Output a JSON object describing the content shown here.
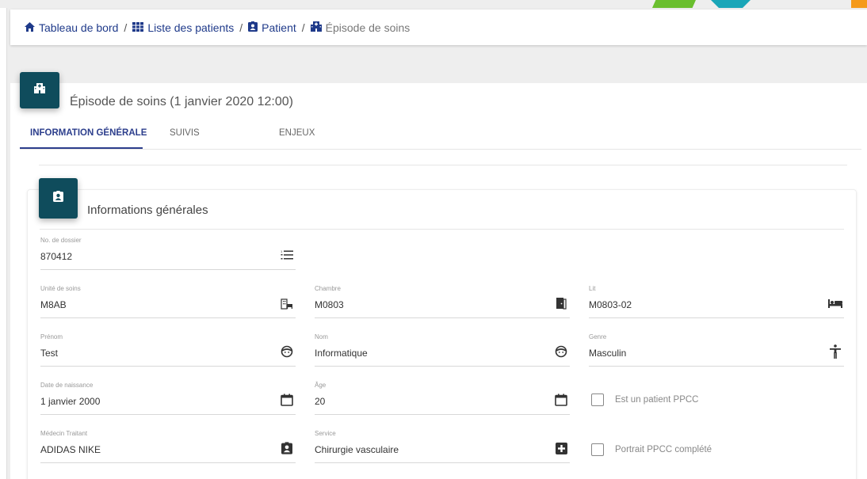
{
  "breadcrumb": {
    "items": [
      {
        "label": "Tableau de bord",
        "icon": "home-icon"
      },
      {
        "label": "Liste des patients",
        "icon": "list-icon"
      },
      {
        "label": "Patient",
        "icon": "patient-card-icon"
      },
      {
        "label": "Épisode de soins",
        "icon": "hospital-icon"
      }
    ],
    "separator": "/"
  },
  "episode": {
    "title": "Épisode de soins (1 janvier 2020 12:00)",
    "icon": "hospital-icon"
  },
  "tabs": [
    {
      "label": "INFORMATION GÉNÉRALE",
      "active": true
    },
    {
      "label": "SUIVIS",
      "active": false
    },
    {
      "label": "ENJEUX",
      "active": false
    }
  ],
  "info": {
    "title": "Informations générales",
    "icon": "patient-card-icon",
    "fields": {
      "dossier": {
        "label": "No. de dossier",
        "value": "870412",
        "icon": "numbered-list-icon"
      },
      "unite": {
        "label": "Unité de soins",
        "value": "M8AB",
        "icon": "hospital-building-icon"
      },
      "chambre": {
        "label": "Chambre",
        "value": "M0803",
        "icon": "door-icon"
      },
      "lit": {
        "label": "Lit",
        "value": "M0803-02",
        "icon": "bed-icon"
      },
      "prenom": {
        "label": "Prénom",
        "value": "Test",
        "icon": "face-icon"
      },
      "nom": {
        "label": "Nom",
        "value": "Informatique",
        "icon": "face-icon"
      },
      "genre": {
        "label": "Genre",
        "value": "Masculin",
        "icon": "person-icon"
      },
      "naissance": {
        "label": "Date de naissance",
        "value": "1 janvier 2000",
        "icon": "calendar-icon"
      },
      "age": {
        "label": "Âge",
        "value": "20",
        "icon": "calendar-icon"
      },
      "medecin": {
        "label": "Médecin Traitant",
        "value": "ADIDAS NIKE",
        "icon": "patient-card-icon"
      },
      "service": {
        "label": "Service",
        "value": "Chirurgie vasculaire",
        "icon": "medical-cross-icon"
      }
    },
    "checkboxes": {
      "ppcc": {
        "label": "Est un patient PPCC",
        "checked": false
      },
      "portrait": {
        "label": "Portrait PPCC complété",
        "checked": false
      }
    }
  },
  "colors": {
    "accent": "#2c3e8c",
    "badge": "#0f4c5c",
    "breadcrumb_link": "#1f3a8a"
  }
}
